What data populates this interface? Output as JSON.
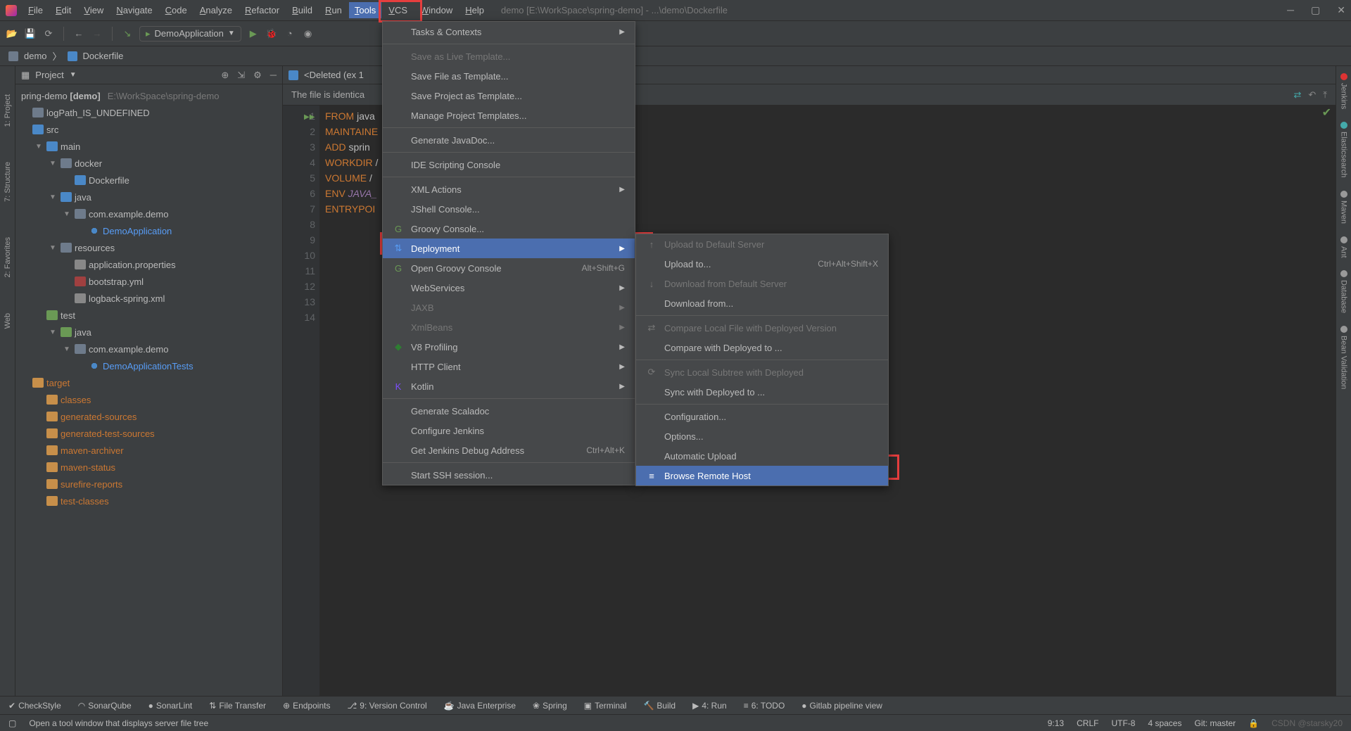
{
  "titlebar": {
    "menu": [
      "File",
      "Edit",
      "View",
      "Navigate",
      "Code",
      "Analyze",
      "Refactor",
      "Build",
      "Run",
      "Tools",
      "VCS",
      "Window",
      "Help"
    ],
    "active_index": 9,
    "project": "demo [E:\\WorkSpace\\spring-demo] - ...\\demo\\Dockerfile"
  },
  "toolbar": {
    "run_config": "DemoApplication"
  },
  "breadcrumb": {
    "items": [
      "demo",
      "Dockerfile"
    ]
  },
  "project_panel": {
    "title": "Project",
    "tree": {
      "root": {
        "label": "pring-demo",
        "suffix": "[demo]",
        "path": "E:\\WorkSpace\\spring-demo"
      },
      "items": [
        {
          "indent": 0,
          "arrow": "",
          "ico": "folder",
          "label": "logPath_IS_UNDEFINED"
        },
        {
          "indent": 0,
          "arrow": "",
          "ico": "folder-blue",
          "label": "src"
        },
        {
          "indent": 1,
          "arrow": "▼",
          "ico": "folder-blue",
          "label": "main"
        },
        {
          "indent": 2,
          "arrow": "▼",
          "ico": "folder",
          "label": "docker"
        },
        {
          "indent": 3,
          "arrow": "",
          "ico": "docker",
          "label": "Dockerfile"
        },
        {
          "indent": 2,
          "arrow": "▼",
          "ico": "folder-blue",
          "label": "java"
        },
        {
          "indent": 3,
          "arrow": "▼",
          "ico": "folder",
          "label": "com.example.demo"
        },
        {
          "indent": 4,
          "arrow": "",
          "ico": "class",
          "label": "DemoApplication",
          "cls": "lbl-blue"
        },
        {
          "indent": 2,
          "arrow": "▼",
          "ico": "folder",
          "label": "resources"
        },
        {
          "indent": 3,
          "arrow": "",
          "ico": "prop",
          "label": "application.properties"
        },
        {
          "indent": 3,
          "arrow": "",
          "ico": "yml",
          "label": "bootstrap.yml"
        },
        {
          "indent": 3,
          "arrow": "",
          "ico": "prop",
          "label": "logback-spring.xml"
        },
        {
          "indent": 1,
          "arrow": "",
          "ico": "folder-green",
          "label": "test"
        },
        {
          "indent": 2,
          "arrow": "▼",
          "ico": "folder-green",
          "label": "java"
        },
        {
          "indent": 3,
          "arrow": "▼",
          "ico": "folder",
          "label": "com.example.demo"
        },
        {
          "indent": 4,
          "arrow": "",
          "ico": "class",
          "label": "DemoApplicationTests",
          "cls": "lbl-blue"
        },
        {
          "indent": 0,
          "arrow": "",
          "ico": "folder-orange",
          "label": "target",
          "cls": "lbl-orange"
        },
        {
          "indent": 1,
          "arrow": "",
          "ico": "folder-orange",
          "label": "classes",
          "cls": "lbl-orange"
        },
        {
          "indent": 1,
          "arrow": "",
          "ico": "folder-orange",
          "label": "generated-sources",
          "cls": "lbl-orange"
        },
        {
          "indent": 1,
          "arrow": "",
          "ico": "folder-orange",
          "label": "generated-test-sources",
          "cls": "lbl-orange"
        },
        {
          "indent": 1,
          "arrow": "",
          "ico": "folder-orange",
          "label": "maven-archiver",
          "cls": "lbl-orange"
        },
        {
          "indent": 1,
          "arrow": "",
          "ico": "folder-orange",
          "label": "maven-status",
          "cls": "lbl-orange"
        },
        {
          "indent": 1,
          "arrow": "",
          "ico": "folder-orange",
          "label": "surefire-reports",
          "cls": "lbl-orange"
        },
        {
          "indent": 1,
          "arrow": "",
          "ico": "folder-orange",
          "label": "test-classes",
          "cls": "lbl-orange"
        }
      ]
    }
  },
  "left_gutter": [
    "1: Project",
    "7: Structure",
    "2: Favorites",
    "Web"
  ],
  "right_gutter": [
    {
      "label": "Jenkins",
      "color": "#d33"
    },
    {
      "label": "Elasticsearch",
      "color": "#4aa"
    },
    {
      "label": "Maven",
      "color": "#999"
    },
    {
      "label": "Ant",
      "color": "#999"
    },
    {
      "label": "Database",
      "color": "#999"
    },
    {
      "label": "Bean Validation",
      "color": "#999"
    }
  ],
  "editor": {
    "tab": "<Deleted (ex 1",
    "banner": "The file is identica",
    "lines": [
      {
        "kw": "FROM",
        "rest": " java"
      },
      {
        "kw": "",
        "rest": ""
      },
      {
        "kw": "MAINTAINE",
        "rest": ""
      },
      {
        "kw": "",
        "rest": ""
      },
      {
        "kw": "ADD",
        "rest": " sprin"
      },
      {
        "kw": "",
        "rest": ""
      },
      {
        "kw": "WORKDIR",
        "rest": " /"
      },
      {
        "kw": "",
        "rest": ""
      },
      {
        "kw": "VOLUME",
        "rest": " /"
      },
      {
        "kw": "",
        "rest": ""
      },
      {
        "kw": "ENV",
        "rest": "",
        "var": " JAVA_"
      },
      {
        "kw": "",
        "rest": ""
      },
      {
        "kw": "ENTRYPOI",
        "rest": ""
      },
      {
        "kw": "",
        "rest": ""
      }
    ]
  },
  "tools_menu": [
    {
      "label": "Tasks & Contexts",
      "arrow": true
    },
    {
      "sep": true
    },
    {
      "label": "Save as Live Template...",
      "disabled": true
    },
    {
      "label": "Save File as Template..."
    },
    {
      "label": "Save Project as Template..."
    },
    {
      "label": "Manage Project Templates..."
    },
    {
      "sep": true
    },
    {
      "label": "Generate JavaDoc..."
    },
    {
      "sep": true
    },
    {
      "label": "IDE Scripting Console"
    },
    {
      "sep": true
    },
    {
      "label": "XML Actions",
      "arrow": true
    },
    {
      "label": "JShell Console..."
    },
    {
      "label": "Groovy Console...",
      "icon": "G",
      "iconColor": "#6a9955"
    },
    {
      "label": "Deployment",
      "arrow": true,
      "hl": true,
      "icon": "⇅",
      "iconColor": "#589df6"
    },
    {
      "label": "Open Groovy Console",
      "shortcut": "Alt+Shift+G",
      "icon": "G",
      "iconColor": "#6a9955"
    },
    {
      "label": "WebServices",
      "arrow": true
    },
    {
      "label": "JAXB",
      "arrow": true,
      "disabled": true
    },
    {
      "label": "XmlBeans",
      "arrow": true,
      "disabled": true
    },
    {
      "label": "V8 Profiling",
      "arrow": true,
      "icon": "◆",
      "iconColor": "#2e7d32"
    },
    {
      "label": "HTTP Client",
      "arrow": true
    },
    {
      "label": "Kotlin",
      "arrow": true,
      "icon": "K",
      "iconColor": "#7c4dff"
    },
    {
      "sep": true
    },
    {
      "label": "Generate Scaladoc"
    },
    {
      "label": "Configure Jenkins"
    },
    {
      "label": "Get Jenkins Debug Address",
      "shortcut": "Ctrl+Alt+K"
    },
    {
      "sep": true
    },
    {
      "label": "Start SSH session..."
    }
  ],
  "deploy_menu": [
    {
      "label": "Upload to Default Server",
      "disabled": true,
      "icon": "↑"
    },
    {
      "label": "Upload to...",
      "shortcut": "Ctrl+Alt+Shift+X"
    },
    {
      "label": "Download from Default Server",
      "disabled": true,
      "icon": "↓"
    },
    {
      "label": "Download from..."
    },
    {
      "sep": true
    },
    {
      "label": "Compare Local File with Deployed Version",
      "disabled": true,
      "icon": "⇄"
    },
    {
      "label": "Compare with Deployed to ..."
    },
    {
      "sep": true
    },
    {
      "label": "Sync Local Subtree with Deployed",
      "disabled": true,
      "icon": "⟳"
    },
    {
      "label": "Sync with Deployed to ..."
    },
    {
      "sep": true
    },
    {
      "label": "Configuration..."
    },
    {
      "label": "Options..."
    },
    {
      "label": "Automatic Upload"
    },
    {
      "label": "Browse Remote Host",
      "hl": true,
      "icon": "≡"
    }
  ],
  "bottom_tools": [
    "CheckStyle",
    "SonarQube",
    "SonarLint",
    "File Transfer",
    "Endpoints",
    "9: Version Control",
    "Java Enterprise",
    "Spring",
    "Terminal",
    "Build",
    "4: Run",
    "6: TODO",
    "Gitlab pipeline view"
  ],
  "status": {
    "hint": "Open a tool window that displays server file tree",
    "pos": "9:13",
    "eol": "CRLF",
    "enc": "UTF-8",
    "indent": "4 spaces",
    "branch": "Git: master",
    "watermark": "CSDN @starsky20"
  }
}
